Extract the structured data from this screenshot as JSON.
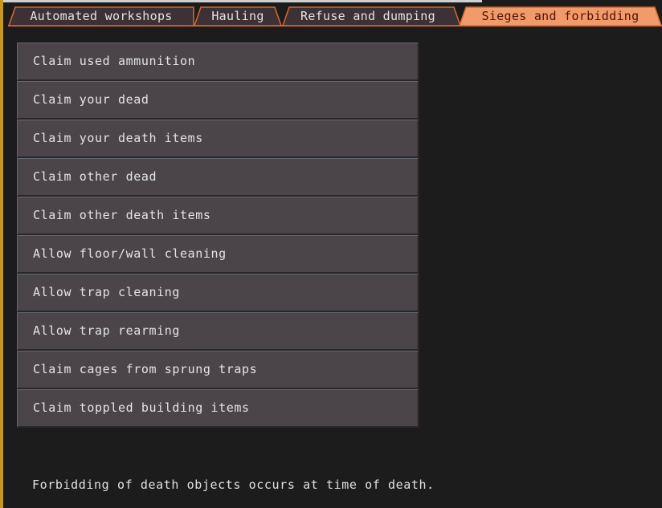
{
  "tabs": [
    {
      "label": "Automated workshops",
      "active": false
    },
    {
      "label": "Hauling",
      "active": false
    },
    {
      "label": "Refuse and dumping",
      "active": false
    },
    {
      "label": "Sieges and forbidding",
      "active": true
    }
  ],
  "options": [
    {
      "label": "Claim used ammunition"
    },
    {
      "label": "Claim your dead"
    },
    {
      "label": "Claim your death items"
    },
    {
      "label": "Claim other dead"
    },
    {
      "label": "Claim other death items"
    },
    {
      "label": "Allow floor/wall cleaning"
    },
    {
      "label": "Allow trap cleaning"
    },
    {
      "label": "Allow trap rearming"
    },
    {
      "label": "Claim cages from sprung traps"
    },
    {
      "label": "Claim toppled building items"
    }
  ],
  "help_text": "Forbidding of death objects occurs at time of death.",
  "colors": {
    "tab_fill": "#3d3135",
    "tab_border": "#d76a2c",
    "tab_active_fill": "#f39a6a",
    "tab_active_text": "#4a1508",
    "button_fill": "#4b4549",
    "background": "#1c1c1c"
  }
}
